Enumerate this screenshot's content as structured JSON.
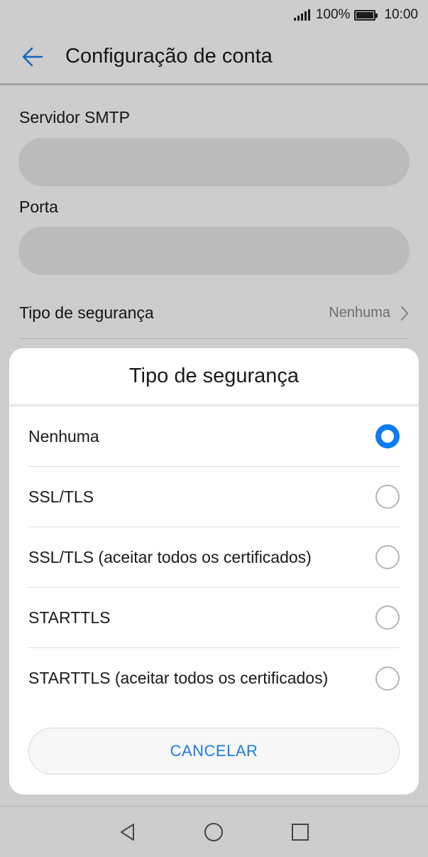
{
  "status_bar": {
    "battery_percent": "100%",
    "time": "10:00",
    "icons": [
      "signal-icon",
      "battery-icon"
    ]
  },
  "header": {
    "title": "Configuração de conta",
    "back_icon": "arrow-left-icon"
  },
  "form": {
    "smtp_label": "Servidor SMTP",
    "smtp_value": "",
    "port_label": "Porta",
    "port_value": "",
    "security_label": "Tipo de segurança",
    "security_value": "Nenhuma"
  },
  "dialog": {
    "title": "Tipo de segurança",
    "options": [
      {
        "label": "Nenhuma",
        "selected": true
      },
      {
        "label": "SSL/TLS",
        "selected": false
      },
      {
        "label": "SSL/TLS (aceitar todos os certificados)",
        "selected": false
      },
      {
        "label": "STARTTLS",
        "selected": false
      },
      {
        "label": "STARTTLS (aceitar todos os certificados)",
        "selected": false
      }
    ],
    "cancel_label": "CANCELAR"
  },
  "nav_bar": {
    "icons": [
      "back-triangle-icon",
      "home-circle-icon",
      "recents-square-icon"
    ]
  },
  "colors": {
    "accent": "#0a7cf5",
    "cancel_text": "#1a7de0",
    "header_arrow": "#1a7de0"
  }
}
